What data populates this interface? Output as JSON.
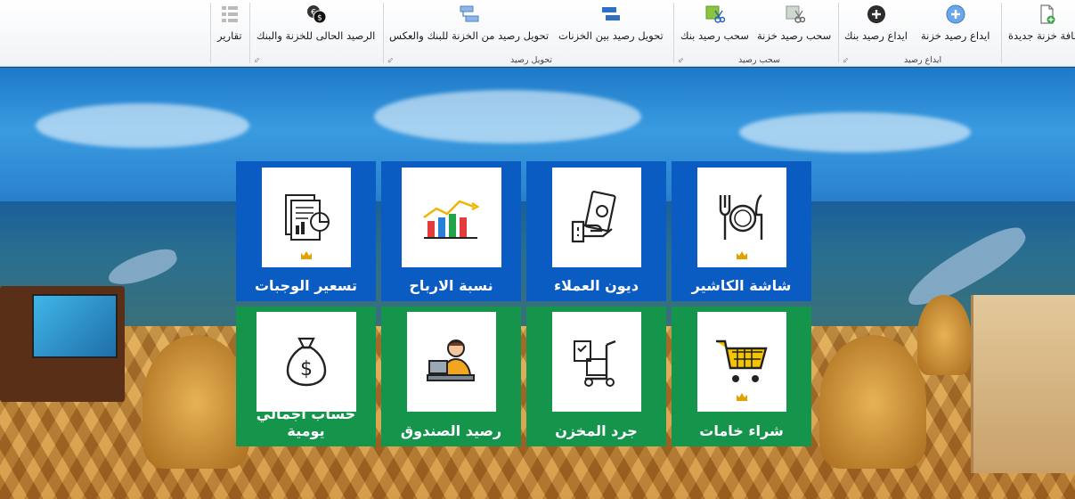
{
  "ribbon": {
    "buttons": {
      "add_treasury": "اضافة خزنة جديدة",
      "deposit_treasury": "ايداع رصيد خزنة",
      "deposit_bank": "ايداع رصيد بنك",
      "withdraw_treasury": "سحب رصيد خزنة",
      "withdraw_bank": "سحب رصيد بنك",
      "transfer_between": "تحويل رصيد بين الخزنات",
      "transfer_bank": "تحويل رصيد من الخزنة للبنك والعكس",
      "current_balance": "الرصيد الحالى للخزنة والبنك",
      "reports": "تقارير"
    },
    "groups": {
      "deposit": "ايداع رصيد",
      "withdraw": "سحب رصيد",
      "transfer": "تحويل رصيد"
    }
  },
  "tiles": [
    {
      "label": "شاشة الكاشير",
      "icon": "cutlery-plate-icon",
      "premium": true,
      "color": "#0a5cc3"
    },
    {
      "label": "ديون العملاء",
      "icon": "cash-hand-icon",
      "premium": false,
      "color": "#0a5cc3"
    },
    {
      "label": "نسبة الارباح",
      "icon": "profit-chart-icon",
      "premium": false,
      "color": "#0a5cc3"
    },
    {
      "label": "تسعير الوجبات",
      "icon": "report-docs-icon",
      "premium": true,
      "color": "#0a5cc3"
    },
    {
      "label": "شراء خامات",
      "icon": "shopping-cart-icon",
      "premium": true,
      "color": "#14954b"
    },
    {
      "label": "جرد المخزن",
      "icon": "hand-truck-icon",
      "premium": false,
      "color": "#14954b"
    },
    {
      "label": "رصيد  الصندوق",
      "icon": "cashier-icon",
      "premium": false,
      "color": "#14954b"
    },
    {
      "label": "حساب اجمالي يومية",
      "icon": "money-bag-icon",
      "premium": false,
      "color": "#14954b"
    }
  ]
}
